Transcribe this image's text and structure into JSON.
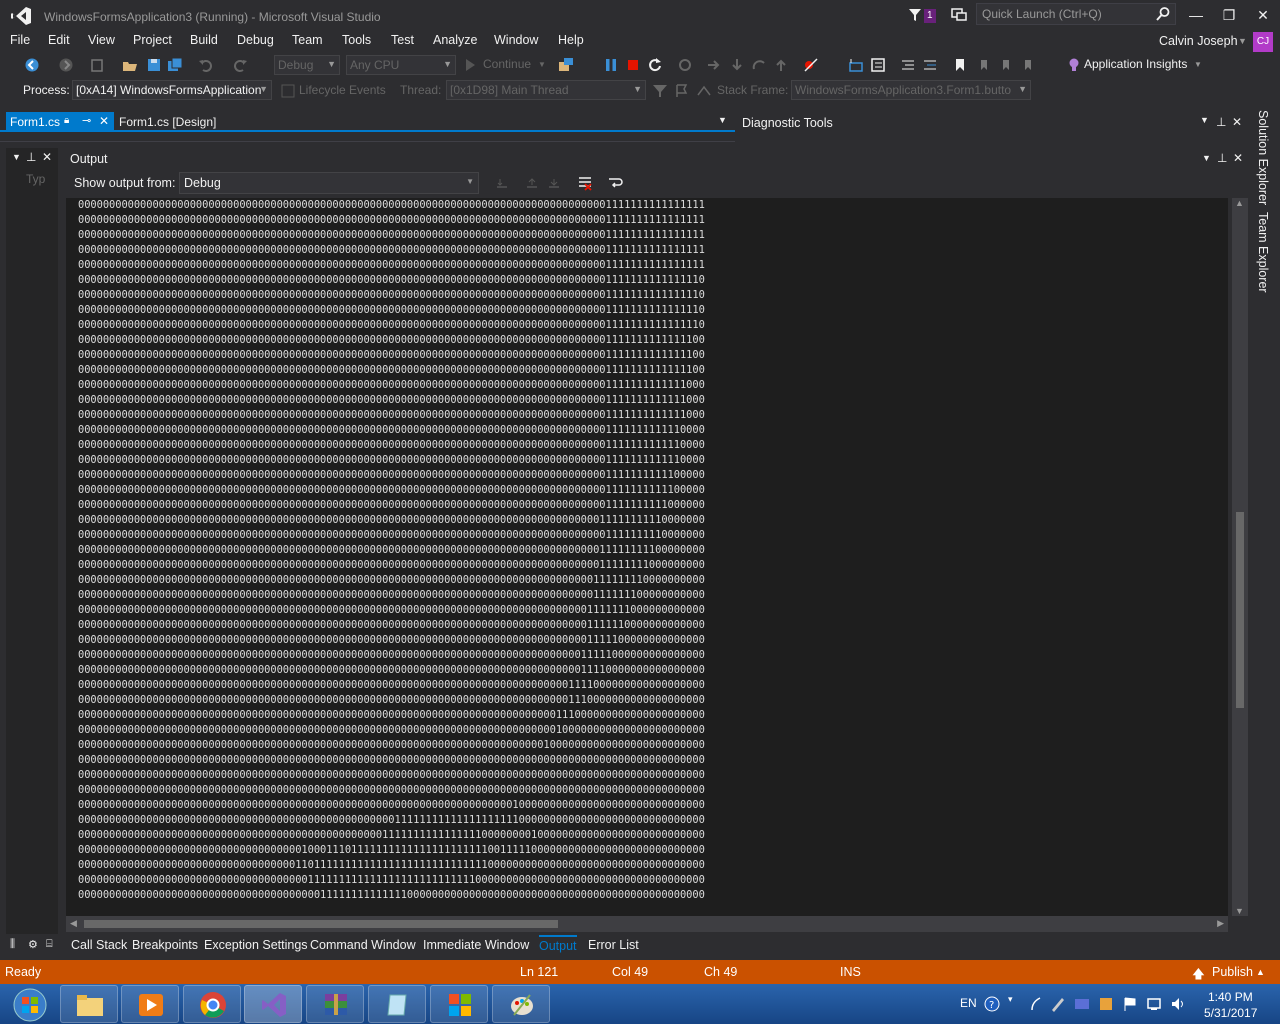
{
  "window": {
    "title": "WindowsFormsApplication3 (Running) - Microsoft Visual Studio",
    "notification_count": "1",
    "quick_launch_placeholder": "Quick Launch (Ctrl+Q)",
    "minimize": "—",
    "maximize": "❐",
    "close": "✕"
  },
  "menu": {
    "items": [
      "File",
      "Edit",
      "View",
      "Project",
      "Build",
      "Debug",
      "Team",
      "Tools",
      "Test",
      "Analyze",
      "Window",
      "Help"
    ],
    "user_name": "Calvin Joseph",
    "user_initials": "CJ"
  },
  "toolbar1": {
    "config": "Debug",
    "platform": "Any CPU",
    "continue": "Continue",
    "app_insights": "Application Insights"
  },
  "toolbar2": {
    "process_label": "Process:",
    "process_value": "[0xA14] WindowsFormsApplication",
    "lifecycle": "Lifecycle Events",
    "thread_label": "Thread:",
    "thread_value": "[0x1D98] Main Thread",
    "stack_label": "Stack Frame:",
    "stack_value": "WindowsFormsApplication3.Form1.butto"
  },
  "doc_tabs": {
    "active": "Form1.cs",
    "inactive": "Form1.cs [Design]",
    "diag_tools": "Diagnostic Tools"
  },
  "left_pane": {
    "stub": "Typ"
  },
  "output": {
    "title": "Output",
    "show_from_label": "Show output from:",
    "show_from_value": "Debug",
    "lines": [
      "00000000000000000000000000000000000000000000000000000000000000000000000000000000000001111111111111111",
      "00000000000000000000000000000000000000000000000000000000000000000000000000000000000001111111111111111",
      "00000000000000000000000000000000000000000000000000000000000000000000000000000000000001111111111111111",
      "00000000000000000000000000000000000000000000000000000000000000000000000000000000000001111111111111111",
      "00000000000000000000000000000000000000000000000000000000000000000000000000000000000001111111111111111",
      "00000000000000000000000000000000000000000000000000000000000000000000000000000000000001111111111111110",
      "00000000000000000000000000000000000000000000000000000000000000000000000000000000000001111111111111110",
      "00000000000000000000000000000000000000000000000000000000000000000000000000000000000001111111111111110",
      "00000000000000000000000000000000000000000000000000000000000000000000000000000000000001111111111111110",
      "00000000000000000000000000000000000000000000000000000000000000000000000000000000000001111111111111100",
      "00000000000000000000000000000000000000000000000000000000000000000000000000000000000001111111111111100",
      "00000000000000000000000000000000000000000000000000000000000000000000000000000000000001111111111111100",
      "00000000000000000000000000000000000000000000000000000000000000000000000000000000000001111111111111000",
      "00000000000000000000000000000000000000000000000000000000000000000000000000000000000001111111111111000",
      "00000000000000000000000000000000000000000000000000000000000000000000000000000000000001111111111111000",
      "00000000000000000000000000000000000000000000000000000000000000000000000000000000000001111111111110000",
      "00000000000000000000000000000000000000000000000000000000000000000000000000000000000001111111111110000",
      "00000000000000000000000000000000000000000000000000000000000000000000000000000000000001111111111110000",
      "00000000000000000000000000000000000000000000000000000000000000000000000000000000000001111111111100000",
      "00000000000000000000000000000000000000000000000000000000000000000000000000000000000001111111111100000",
      "00000000000000000000000000000000000000000000000000000000000000000000000000000000000001111111111000000",
      "00000000000000000000000000000000000000000000000000000000000000000000000000000000000011111111110000000",
      "00000000000000000000000000000000000000000000000000000000000000000000000000000000000001111111110000000",
      "00000000000000000000000000000000000000000000000000000000000000000000000000000000000011111111100000000",
      "00000000000000000000000000000000000000000000000000000000000000000000000000000000000011111111000000000",
      "00000000000000000000000000000000000000000000000000000000000000000000000000000000000111111110000000000",
      "00000000000000000000000000000000000000000000000000000000000000000000000000000000000111111100000000000",
      "00000000000000000000000000000000000000000000000000000000000000000000000000000000001111111000000000000",
      "00000000000000000000000000000000000000000000000000000000000000000000000000000000001111110000000000000",
      "00000000000000000000000000000000000000000000000000000000000000000000000000000000001111100000000000000",
      "00000000000000000000000000000000000000000000000000000000000000000000000000000000011111000000000000000",
      "00000000000000000000000000000000000000000000000000000000000000000000000000000000011110000000000000000",
      "00000000000000000000000000000000000000000000000000000000000000000000000000000001111000000000000000000",
      "00000000000000000000000000000000000000000000000000000000000000000000000000000001110000000000000000000",
      "00000000000000000000000000000000000000000000000000000000000000000000000000000111000000000000000000000",
      "00000000000000000000000000000000000000000000000000000000000000000000000000000100000000000000000000000",
      "00000000000000000000000000000000000000000000000000000000000000000000000000010000000000000000000000000",
      "00000000000000000000000000000000000000000000000000000000000000000000000000000000000000000000000000000",
      "00000000000000000000000000000000000000000000000000000000000000000000000000000000000000000000000000000",
      "00000000000000000000000000000000000000000000000000000000000000000000000000000000000000000000000000000",
      "00000000000000000000000000000000000000000000000000000000000000000000001000000000000000000000000000000",
      "00000000000000000000000000000000000000000000000000011111111111111111111000000000000000000000000000000",
      "00000000000000000000000000000000000000000000000001111111111111111000000001000000000000000000000000000",
      "00000000000000000000000000000000000010001110111111111111111111111100111110000000000000000000000000000",
      "00000000000000000000000000000000000110111111111111111111111111111100000000000000000000000000000000000",
      "00000000000000000000000000000000000001111111111111111111111111110000000000000000000000000000000000000",
      "00000000000000000000000000000000000000011111111111111000000000000000000000000000000000000000000000000"
    ]
  },
  "side_tabs": [
    "Solution Explorer",
    "Team Explorer"
  ],
  "tool_tabs": [
    "Call Stack",
    "Breakpoints",
    "Exception Settings",
    "Command Window",
    "Immediate Window",
    "Output",
    "Error List"
  ],
  "status": {
    "ready": "Ready",
    "line": "Ln 121",
    "col": "Col 49",
    "ch": "Ch 49",
    "mode": "INS",
    "publish": "Publish"
  },
  "taskbar": {
    "lang": "EN",
    "time": "1:40 PM",
    "date": "5/31/2017"
  },
  "colors": {
    "accent": "#007acc",
    "status_bar": "#ca5100",
    "vs_purple": "#68217a"
  }
}
